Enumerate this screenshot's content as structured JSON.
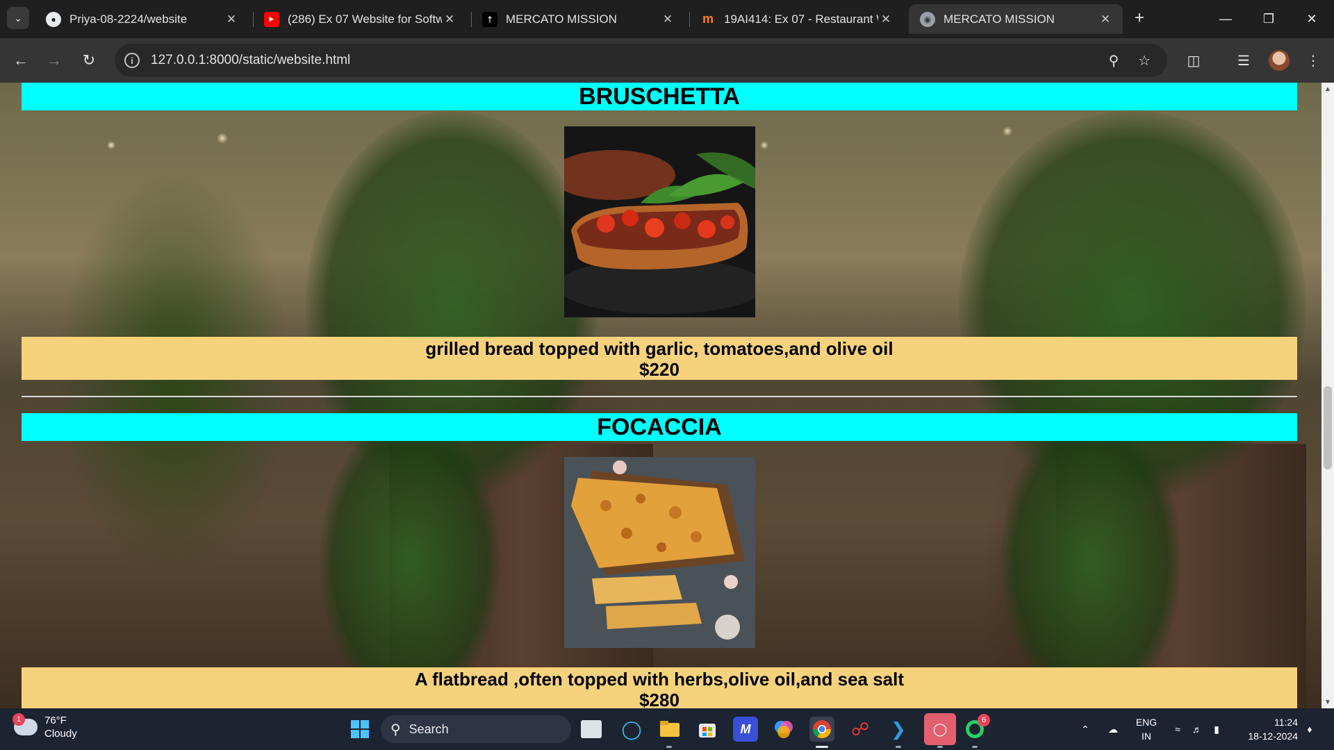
{
  "browser": {
    "tab_search_icon": "chevron-down-icon",
    "tabs": [
      {
        "title": "Priya-08-2224/website",
        "favicon": "github-icon"
      },
      {
        "title": "(286) Ex 07 Website for Softw",
        "favicon": "youtube-icon"
      },
      {
        "title": "MERCATO MISSION",
        "favicon": "site-icon"
      },
      {
        "title": "19AI414: Ex 07 - Restaurant W",
        "favicon": "moodle-icon"
      },
      {
        "title": "MERCATO MISSION",
        "favicon": "globe-icon"
      }
    ],
    "active_tab_index": 4,
    "url": "127.0.0.1:8000/static/website.html"
  },
  "page": {
    "items": [
      {
        "name": "BRUSCHETTA",
        "description": "grilled bread topped with garlic, tomatoes,and olive oil",
        "price": "$220"
      },
      {
        "name": "FOCACCIA",
        "description": "A flatbread ,often topped with herbs,olive oil,and sea salt",
        "price": "$280"
      }
    ],
    "colors": {
      "title_bar": "#00ffff",
      "description_bar": "#f6d27d"
    }
  },
  "taskbar": {
    "weather": {
      "badge": "1",
      "temp": "76°F",
      "condition": "Cloudy"
    },
    "search_placeholder": "Search",
    "whatsapp_badge": "6",
    "language": {
      "line1": "ENG",
      "line2": "IN"
    },
    "time": "11:24",
    "date": "18-12-2024"
  }
}
